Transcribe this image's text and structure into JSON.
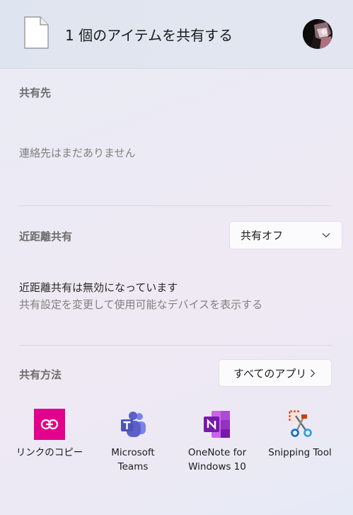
{
  "header": {
    "title": "1 個のアイテムを共有する",
    "file_icon": "document-icon",
    "avatar": "user-avatar"
  },
  "contacts": {
    "label": "共有先",
    "empty_text": "連絡先はまだありません"
  },
  "nearby": {
    "label": "近距離共有",
    "dropdown_value": "共有オフ",
    "status_text": "近距離共有は無効になっています",
    "hint_text": "共有設定を変更して使用可能なデバイスを表示する"
  },
  "share_method": {
    "label": "共有方法",
    "all_apps_label": "すべてのアプリ",
    "apps": [
      {
        "name": "リンクのコピー",
        "icon": "link-icon",
        "color": "#e3008c"
      },
      {
        "name": "Microsoft\nTeams",
        "icon": "teams-icon",
        "color": "#5b5fc7"
      },
      {
        "name": "OneNote for\nWindows 10",
        "icon": "onenote-icon",
        "color": "#7719aa"
      },
      {
        "name": "Snipping Tool",
        "icon": "scissors-icon",
        "color": "#d83b01"
      }
    ]
  }
}
